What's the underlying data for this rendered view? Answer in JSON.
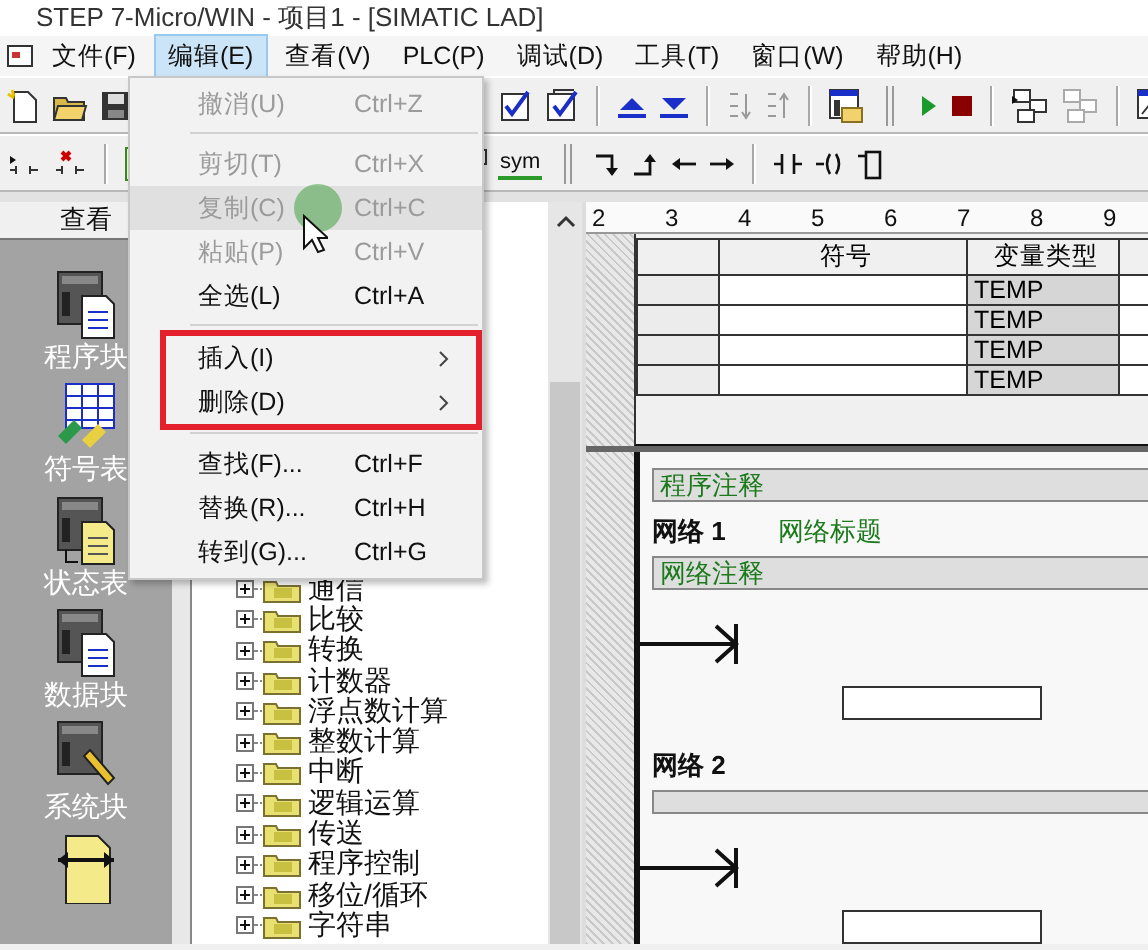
{
  "window": {
    "title": "STEP 7-Micro/WIN - 项目1 - [SIMATIC LAD]"
  },
  "menu_bar": [
    {
      "label": "文件(F)",
      "selected": false
    },
    {
      "label": "编辑(E)",
      "selected": true
    },
    {
      "label": "查看(V)",
      "selected": false
    },
    {
      "label": "PLC(P)",
      "selected": false
    },
    {
      "label": "调试(D)",
      "selected": false
    },
    {
      "label": "工具(T)",
      "selected": false
    },
    {
      "label": "窗口(W)",
      "selected": false
    },
    {
      "label": "帮助(H)",
      "selected": false
    }
  ],
  "toolbar_2": {
    "sym_button": "sym"
  },
  "navigation_bar": {
    "header": "查看",
    "items": [
      {
        "label": "程序块"
      },
      {
        "label": "符号表"
      },
      {
        "label": "状态表"
      },
      {
        "label": "数据块"
      },
      {
        "label": "系统块"
      }
    ]
  },
  "instruction_tree": {
    "items": [
      {
        "label": "通信",
        "expanded": false
      },
      {
        "label": "比较",
        "expanded": false
      },
      {
        "label": "转换",
        "expanded": false
      },
      {
        "label": "计数器",
        "expanded": false
      },
      {
        "label": "浮点数计算",
        "expanded": false
      },
      {
        "label": "整数计算",
        "expanded": false
      },
      {
        "label": "中断",
        "expanded": false
      },
      {
        "label": "逻辑运算",
        "expanded": false
      },
      {
        "label": "传送",
        "expanded": false
      },
      {
        "label": "程序控制",
        "expanded": false
      },
      {
        "label": "移位/循环",
        "expanded": false
      },
      {
        "label": "字符串",
        "expanded": false
      }
    ]
  },
  "ruler": {
    "marks": [
      "2",
      "3",
      "4",
      "5",
      "6",
      "7",
      "8",
      "9"
    ]
  },
  "variable_table": {
    "columns": [
      "符号",
      "变量类型"
    ],
    "rows": [
      {
        "variable_type": "TEMP"
      },
      {
        "variable_type": "TEMP"
      },
      {
        "variable_type": "TEMP"
      },
      {
        "variable_type": "TEMP"
      }
    ]
  },
  "ladder": {
    "program_comment": "程序注释",
    "networks": [
      {
        "label": "网络 1",
        "title": "网络标题",
        "comment": "网络注释"
      },
      {
        "label": "网络 2"
      }
    ]
  },
  "edit_menu": {
    "sections": [
      {
        "framed": false,
        "items": [
          {
            "kind": "command",
            "label": "撤消(U)",
            "shortcut": "Ctrl+Z",
            "disabled": true,
            "selected": false
          }
        ]
      },
      {
        "framed": false,
        "items": [
          {
            "kind": "command",
            "label": "剪切(T)",
            "shortcut": "Ctrl+X",
            "disabled": true,
            "selected": false
          },
          {
            "kind": "command",
            "label": "复制(C)",
            "shortcut": "Ctrl+C",
            "disabled": true,
            "selected": true
          },
          {
            "kind": "command",
            "label": "粘贴(P)",
            "shortcut": "Ctrl+V",
            "disabled": true,
            "selected": false
          },
          {
            "kind": "command",
            "label": "全选(L)",
            "shortcut": "Ctrl+A",
            "disabled": false,
            "selected": false
          }
        ]
      },
      {
        "framed": true,
        "items": [
          {
            "kind": "submenu",
            "label": "插入(I)",
            "disabled": false,
            "selected": false
          },
          {
            "kind": "submenu",
            "label": "删除(D)",
            "disabled": false,
            "selected": false
          }
        ]
      },
      {
        "framed": false,
        "items": [
          {
            "kind": "command",
            "label": "查找(F)...",
            "shortcut": "Ctrl+F",
            "disabled": false,
            "selected": false
          },
          {
            "kind": "command",
            "label": "替换(R)...",
            "shortcut": "Ctrl+H",
            "disabled": false,
            "selected": false
          },
          {
            "kind": "command",
            "label": "转到(G)...",
            "shortcut": "Ctrl+G",
            "disabled": false,
            "selected": false
          }
        ]
      }
    ]
  }
}
